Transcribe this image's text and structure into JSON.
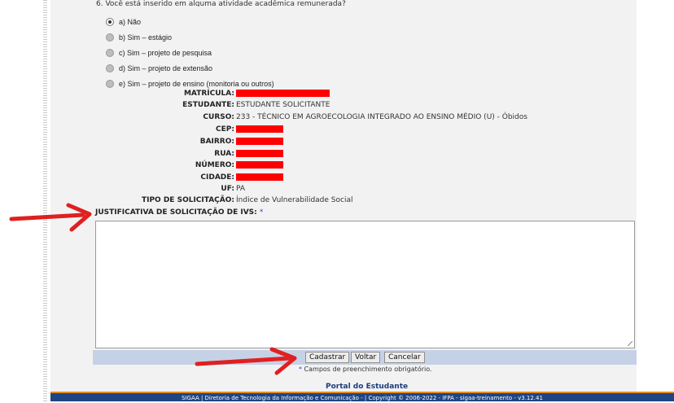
{
  "question_fragment": "6.  Você está inserido em alguma atividade acadêmica remunerada?",
  "options": [
    {
      "label": "a) Não",
      "checked": true
    },
    {
      "label": "b) Sim – estágio",
      "checked": false
    },
    {
      "label": "c) Sim – projeto de pesquisa",
      "checked": false
    },
    {
      "label": "d) Sim – projeto de extensão",
      "checked": false
    },
    {
      "label": "e) Sim – projeto de ensino (monitoria ou outros)",
      "checked": false
    }
  ],
  "fields": [
    {
      "label": "MATRÍCULA:",
      "value": "",
      "redacted": true
    },
    {
      "label": "ESTUDANTE:",
      "value": "ESTUDANTE SOLICITANTE",
      "redacted": false
    },
    {
      "label": "CURSO:",
      "value": "233 - TÉCNICO EM AGROECOLOGIA INTEGRADO AO ENSINO MÉDIO (U) - Óbidos",
      "redacted": false
    },
    {
      "label": "CEP:",
      "value": "",
      "redacted": true
    },
    {
      "label": "BAIRRO:",
      "value": "",
      "redacted": true
    },
    {
      "label": "RUA:",
      "value": "",
      "redacted": true
    },
    {
      "label": "NÚMERO:",
      "value": "",
      "redacted": true
    },
    {
      "label": "CIDADE:",
      "value": "",
      "redacted": true
    },
    {
      "label": "UF:",
      "value": "PA",
      "redacted": false
    },
    {
      "label": "TIPO DE SOLICITAÇÃO:",
      "value": "Índice de Vulnerabilidade Social",
      "redacted": false
    }
  ],
  "justificativa_label": "JUSTIFICATIVA DE SOLICITAÇÃO DE IVS:",
  "required_star": "*",
  "buttons": {
    "cadastrar": "Cadastrar",
    "voltar": "Voltar",
    "cancelar": "Cancelar"
  },
  "required_note": "Campos de preenchimento obrigatório.",
  "portal_link": "Portal do Estudante",
  "footer_text": "SIGAA | Diretoria de Tecnologia da Informação e Comunicação - | Copyright © 2006-2022 - IFPA - sigaa-treinamento - v3.12.41",
  "colors": {
    "arrow": "#e02020",
    "redaction": "#ff0000",
    "footer_bg": "#1f4583",
    "button_bar": "#c5d2e6"
  }
}
